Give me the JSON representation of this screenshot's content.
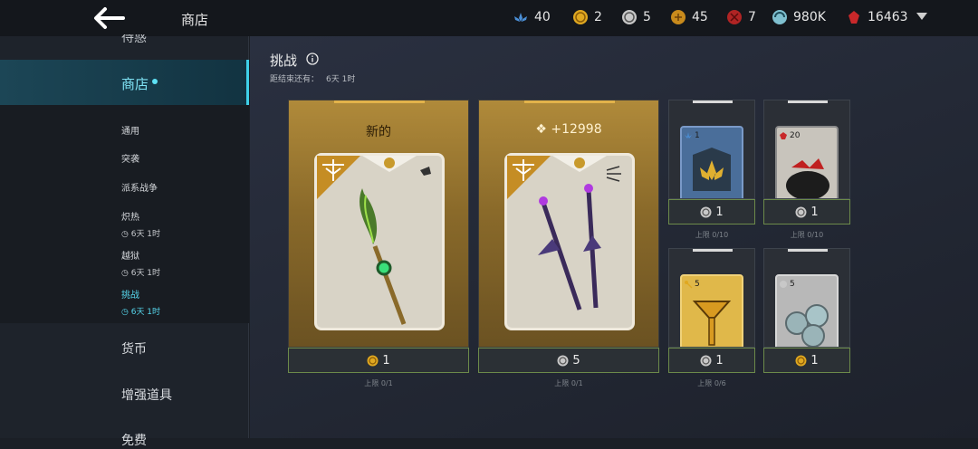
{
  "topbar": {
    "title": "商店",
    "currencies": [
      {
        "icon": "lotus-icon",
        "value": "40",
        "color": "#4b8fd6"
      },
      {
        "icon": "gold-coin-icon",
        "value": "2",
        "color": "#e0a820"
      },
      {
        "icon": "silver-coin-icon",
        "value": "5",
        "color": "#c8c8c8"
      },
      {
        "icon": "bronze-coin-icon",
        "value": "45",
        "color": "#c88a1c"
      },
      {
        "icon": "red-coin-icon",
        "value": "7",
        "color": "#b02424"
      },
      {
        "icon": "energy-orb-icon",
        "value": "980K",
        "color": "#7fc0d0"
      },
      {
        "icon": "red-gem-icon",
        "value": "16463",
        "color": "#c8282a"
      }
    ]
  },
  "sidebar": {
    "cut_item": "待惑",
    "main_item": "商店",
    "sub_items": [
      {
        "label": "通用"
      },
      {
        "label": "突袭"
      },
      {
        "label": "派系战争"
      },
      {
        "label": "炽热",
        "time": "6天 1时"
      },
      {
        "label": "越狱",
        "time": "6天 1时"
      },
      {
        "label": "挑战",
        "time": "6天 1时"
      }
    ],
    "categories": [
      "货币",
      "增强道具",
      "免费"
    ]
  },
  "section": {
    "title": "挑战",
    "subtitle_label": "距结束还有：",
    "subtitle_time": "6天 1时"
  },
  "cards": [
    {
      "header": "新的",
      "price": "1",
      "limit": "上限 0/1",
      "price_icon": "gold-coin-icon"
    },
    {
      "header": "+12998",
      "price": "5",
      "limit": "上限 0/1",
      "price_icon": "silver-coin-icon"
    }
  ],
  "small_cards": [
    {
      "qty": "1",
      "price": "1",
      "limit": "上限 0/10",
      "price_icon": "silver-coin-icon",
      "item": "gold-medallion-icon"
    },
    {
      "qty": "20",
      "price": "1",
      "limit": "上限 0/10",
      "price_icon": "silver-coin-icon",
      "item": "red-gem-pouch-icon"
    },
    {
      "qty": "5",
      "price": "1",
      "limit": "上限 0/6",
      "price_icon": "silver-coin-icon",
      "item": "gold-key-icon"
    },
    {
      "qty": "5",
      "price": "1",
      "limit": "",
      "price_icon": "gold-coin-icon",
      "item": "silver-coins-icon"
    }
  ]
}
